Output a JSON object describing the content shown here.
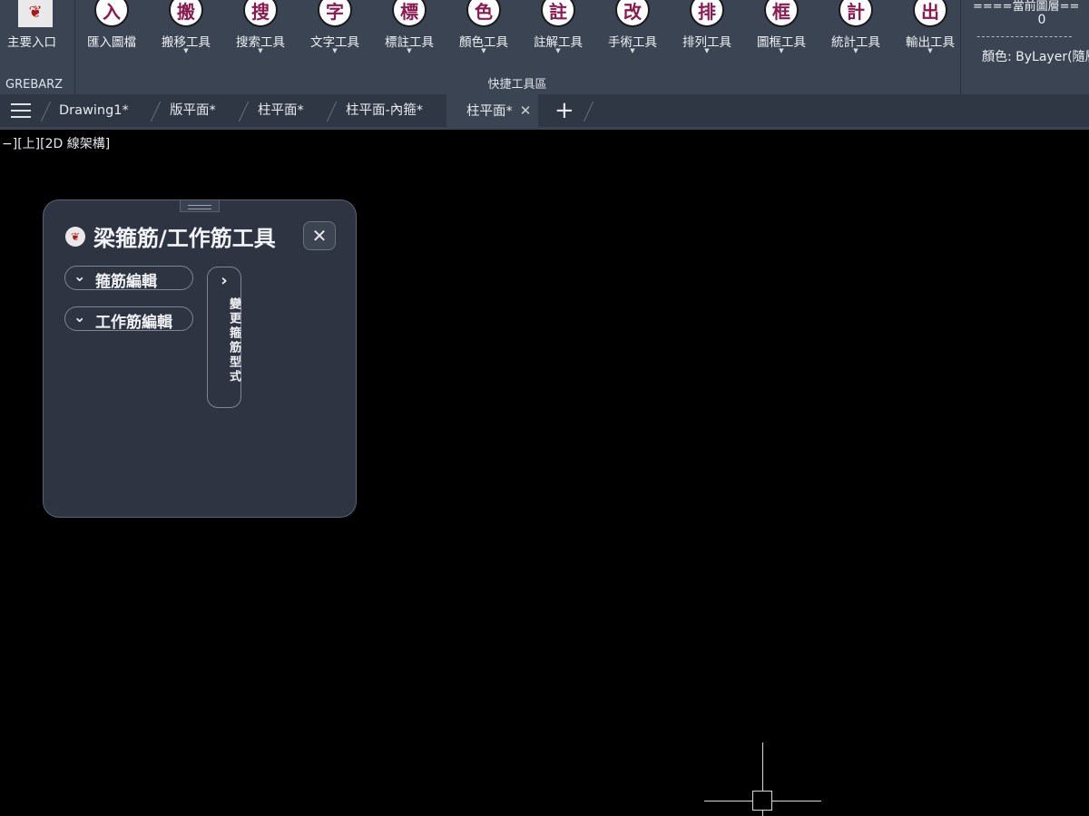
{
  "ribbon": {
    "grebarz": {
      "main_entry_label": "主要入口",
      "section_label": "GREBARZ"
    },
    "quick": {
      "section_label": "快捷工具區",
      "tools": [
        {
          "glyph": "入",
          "label": "匯入圖檔",
          "caret": false
        },
        {
          "glyph": "搬",
          "label": "搬移工具",
          "caret": true
        },
        {
          "glyph": "搜",
          "label": "搜索工具",
          "caret": true
        },
        {
          "glyph": "字",
          "label": "文字工具",
          "caret": true
        },
        {
          "glyph": "標",
          "label": "標註工具",
          "caret": true
        },
        {
          "glyph": "色",
          "label": "顏色工具",
          "caret": true
        },
        {
          "glyph": "註",
          "label": "註解工具",
          "caret": true
        },
        {
          "glyph": "改",
          "label": "手術工具",
          "caret": true
        },
        {
          "glyph": "排",
          "label": "排列工具",
          "caret": true
        },
        {
          "glyph": "框",
          "label": "圖框工具",
          "caret": true
        },
        {
          "glyph": "計",
          "label": "統計工具",
          "caret": true
        },
        {
          "glyph": "出",
          "label": "輸出工具",
          "caret": true
        }
      ]
    },
    "layer": {
      "header": "====當前圖層==",
      "current": "0",
      "divider": "--------------------",
      "color": "顏色: ByLayer(隨層"
    }
  },
  "tabs": [
    {
      "label": "Drawing1*"
    },
    {
      "label": "版平面*"
    },
    {
      "label": "柱平面*"
    },
    {
      "label": "柱平面-內箍*"
    },
    {
      "label": "柱平面*",
      "active": true,
      "close": "✕"
    }
  ],
  "tab_add": "+",
  "viewport": {
    "label": "−][上][2D 線架構]"
  },
  "palette": {
    "title": "梁箍筋/工作筋工具",
    "close": "✕",
    "sections": [
      {
        "label": "箍筋編輯"
      },
      {
        "label": "工作筋編輯"
      }
    ],
    "side_button": {
      "label": "變更箍筋型式"
    }
  },
  "colors": {
    "ribbon_bg": "#3b4453",
    "canvas_bg": "#000000",
    "icon_glyph": "#8d1a4f",
    "palette_bg": "#2e3442"
  }
}
